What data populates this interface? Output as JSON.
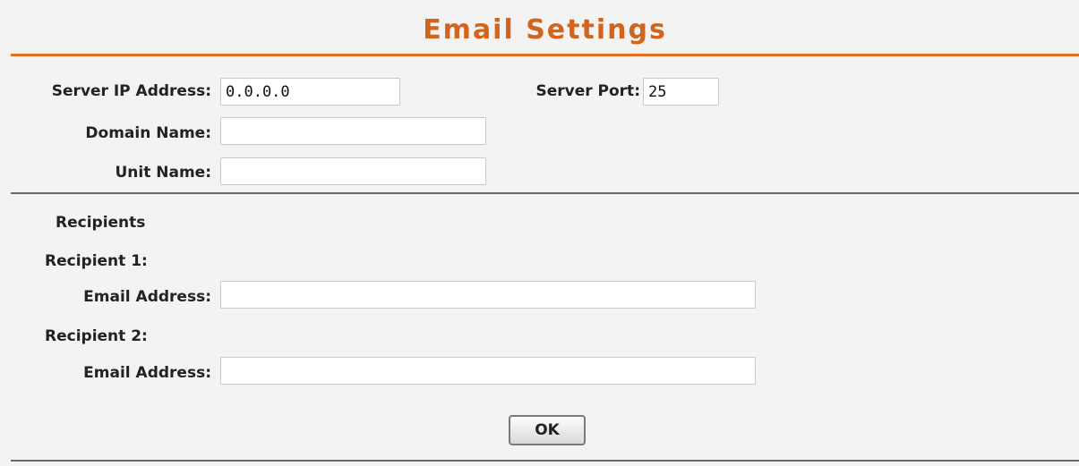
{
  "header": {
    "title": "Email Settings"
  },
  "server": {
    "ip_label": "Server IP Address:",
    "ip_value": "0.0.0.0",
    "port_label": "Server Port:",
    "port_value": "25",
    "domain_label": "Domain Name:",
    "domain_value": "",
    "unit_label": "Unit Name:",
    "unit_value": ""
  },
  "recipients": {
    "heading": "Recipients",
    "items": [
      {
        "label": "Recipient 1:",
        "email_label": "Email Address:",
        "email_value": ""
      },
      {
        "label": "Recipient 2:",
        "email_label": "Email Address:",
        "email_value": ""
      }
    ]
  },
  "actions": {
    "ok_label": "OK"
  },
  "colors": {
    "title": "#d2641c",
    "title_rule": "#e56f1e",
    "background": "#f3f3f3",
    "divider": "#6a6a6a"
  }
}
